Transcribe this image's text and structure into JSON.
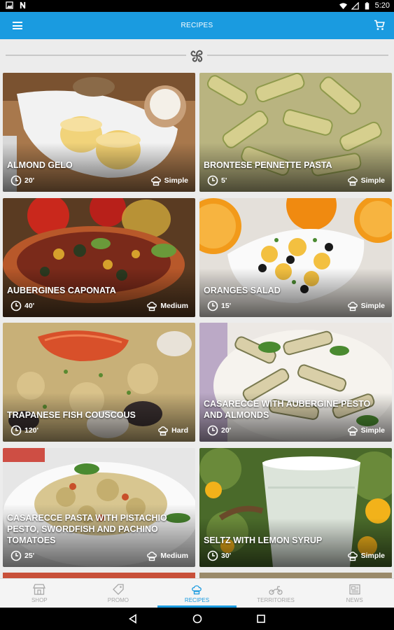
{
  "status_bar": {
    "time": "5:20"
  },
  "app_bar": {
    "title": "RECIPES"
  },
  "recipes": [
    {
      "name": "ALMOND GELO",
      "time": "20'",
      "difficulty": "Simple"
    },
    {
      "name": "BRONTESE PENNETTE PASTA",
      "time": "5'",
      "difficulty": "Simple"
    },
    {
      "name": "AUBERGINES CAPONATA",
      "time": "40'",
      "difficulty": "Medium"
    },
    {
      "name": "ORANGES SALAD",
      "time": "15'",
      "difficulty": "Simple"
    },
    {
      "name": "TRAPANESE FISH COUSCOUS",
      "time": "120'",
      "difficulty": "Hard"
    },
    {
      "name": "CASARECCE WITH AUBERGINE PESTO AND ALMONDS",
      "time": "20'",
      "difficulty": "Simple"
    },
    {
      "name": "CASARECCE PASTA WITH PISTACHIO PESTO, SWORDFISH AND PACHINO TOMATOES",
      "time": "25'",
      "difficulty": "Medium"
    },
    {
      "name": "SELTZ WITH LEMON SYRUP",
      "time": "30'",
      "difficulty": "Simple"
    }
  ],
  "bottom_nav": [
    {
      "label": "SHOP",
      "icon": "shop-icon",
      "active": false
    },
    {
      "label": "PROMO",
      "icon": "tag-icon",
      "active": false
    },
    {
      "label": "RECIPES",
      "icon": "chef-hat-icon",
      "active": true
    },
    {
      "label": "TERRITORIES",
      "icon": "moped-icon",
      "active": false
    },
    {
      "label": "NEWS",
      "icon": "newspaper-icon",
      "active": false
    }
  ],
  "colors": {
    "accent": "#1a9be0",
    "inactive_nav": "#a8a8a8"
  }
}
